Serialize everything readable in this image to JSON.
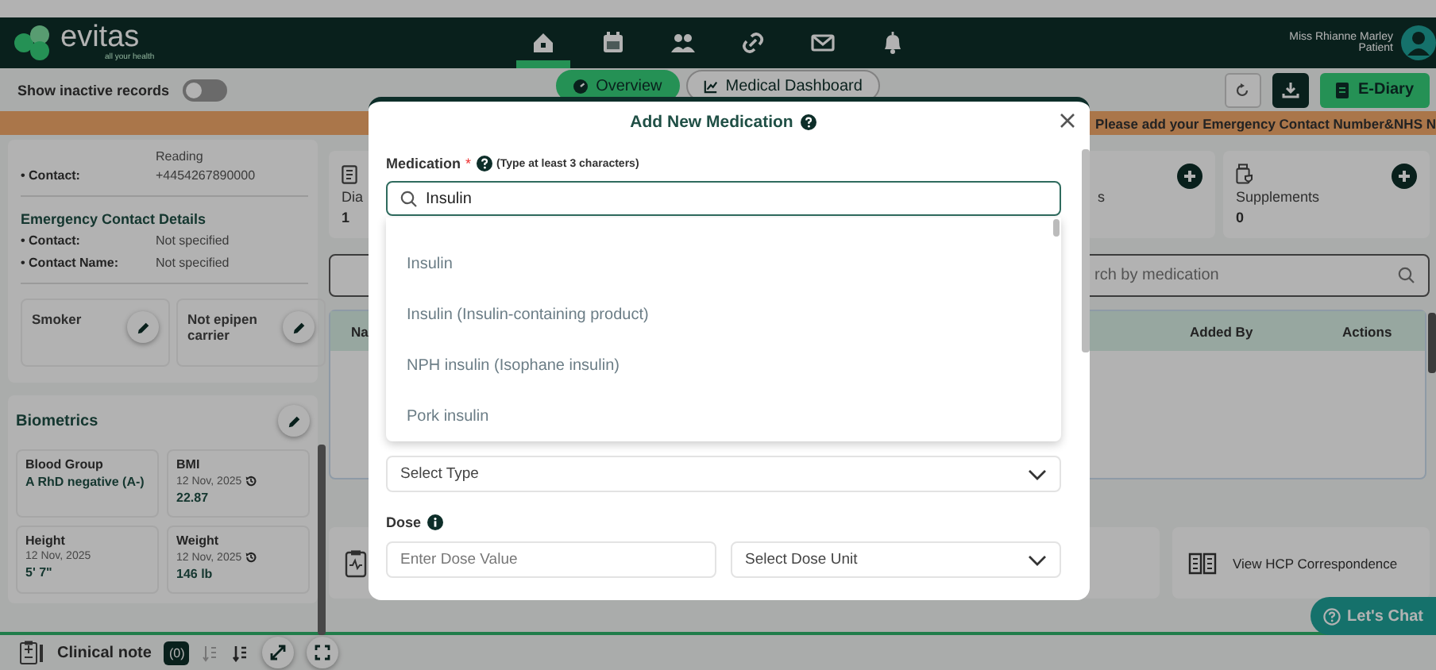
{
  "header": {
    "logo": {
      "name": "evitas",
      "tagline": "all your health"
    },
    "nav": [
      {
        "selected": true
      },
      {
        "selected": false
      },
      {
        "selected": false
      },
      {
        "selected": false
      },
      {
        "selected": false
      },
      {
        "selected": false
      }
    ],
    "user": {
      "name": "Miss Rhianne Marley",
      "role": "Patient"
    }
  },
  "toolbar": {
    "inactive_toggle": {
      "label": "Show inactive records",
      "on": false
    },
    "tabs": [
      {
        "label": "Overview",
        "selected": true
      },
      {
        "label": "Medical Dashboard",
        "selected": false
      }
    ],
    "e_diary": "E-Diary"
  },
  "banner": "Please add your Emergency Contact Number&NHS N",
  "contact_card": {
    "column_label": "Reading",
    "rows": [
      {
        "label": "• Contact:",
        "value": "+4454267890000"
      }
    ],
    "emergency": {
      "title": "Emergency Contact Details",
      "rows": [
        {
          "label": "• Contact:",
          "value": "Not specified"
        },
        {
          "label": "• Contact Name:",
          "value": "Not specified"
        }
      ]
    },
    "flags": [
      "Smoker",
      "Not epipen carrier"
    ]
  },
  "biometrics": {
    "title": "Biometrics",
    "items": [
      {
        "label": "Blood Group",
        "value": "A RhD negative (A-)"
      },
      {
        "label": "BMI",
        "date": "12 Nov, 2025",
        "history": true,
        "value": "22.87"
      },
      {
        "label": "Height",
        "date": "12 Nov, 2025",
        "history": false,
        "value": "5' 7\""
      },
      {
        "label": "Weight",
        "date": "12 Nov, 2025",
        "history": true,
        "value": "146 lb"
      }
    ]
  },
  "summary_cards": [
    {
      "label": "Dia",
      "count": "1"
    },
    {
      "label": "s",
      "add": true
    },
    {
      "label": "Supplements",
      "count": "0",
      "add": true
    }
  ],
  "search": {
    "placeholder": "rch by medication"
  },
  "table": {
    "columns": [
      "Na",
      "Added By",
      "Actions"
    ]
  },
  "links": [
    "View HCP Correspondence"
  ],
  "chat_button": "Let's Chat",
  "clinical_note": {
    "label": "Clinical note",
    "count": "(0)"
  },
  "modal": {
    "title": "Add New Medication",
    "medication": {
      "label": "Medication",
      "required_mark": "*",
      "hint": "(Type at least 3 characters)",
      "value": "Insulin",
      "options": [
        "Insulin",
        "Insulin (Insulin-containing product)",
        "NPH insulin (Isophane insulin)",
        "Pork insulin"
      ]
    },
    "type_select": {
      "placeholder": "Select Type"
    },
    "dose": {
      "label": "Dose",
      "value_placeholder": "Enter Dose Value",
      "unit_placeholder": "Select Dose Unit"
    }
  }
}
